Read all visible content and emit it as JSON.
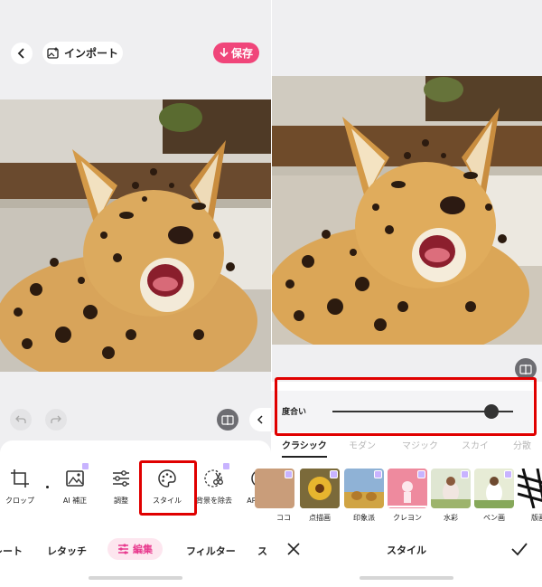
{
  "left_screen": {
    "header": {
      "import_label": "インポート",
      "save_label": "保存"
    },
    "tools": [
      {
        "label": "クロップ",
        "icon": "crop-icon"
      },
      {
        "label": "AI 補正",
        "icon": "ai-enhance-icon"
      },
      {
        "label": "調整",
        "icon": "adjust-sliders-icon"
      },
      {
        "label": "スタイル",
        "icon": "palette-icon"
      },
      {
        "label": "背景を除去",
        "icon": "scissors-icon"
      },
      {
        "label": "AR 効果",
        "icon": "smile-icon"
      }
    ],
    "tabs": [
      {
        "label": "レート"
      },
      {
        "label": "レタッチ"
      },
      {
        "label": "編集"
      },
      {
        "label": "フィルター"
      },
      {
        "label": "ス"
      }
    ]
  },
  "right_screen": {
    "slider": {
      "label": "度合い",
      "value": 0.88
    },
    "style_tabs": [
      {
        "label": "クラシック"
      },
      {
        "label": "モダン"
      },
      {
        "label": "マジック"
      },
      {
        "label": "スカイ"
      },
      {
        "label": "分散"
      }
    ],
    "styles": [
      {
        "label": "ココ"
      },
      {
        "label": "点描画"
      },
      {
        "label": "印象派"
      },
      {
        "label": "クレヨン"
      },
      {
        "label": "水彩"
      },
      {
        "label": "ペン画"
      },
      {
        "label": "版画"
      }
    ],
    "bottom_title": "スタイル"
  },
  "colors": {
    "accent": "#f0457a",
    "highlight_box": "#e00000",
    "active_tab": "#e8398e",
    "background": "#efeff1"
  }
}
